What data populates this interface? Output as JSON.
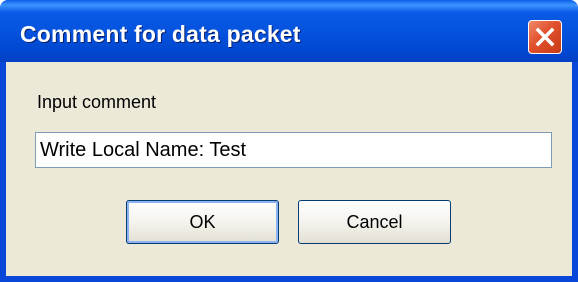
{
  "dialog": {
    "title": "Comment for data packet",
    "close_icon": "close-icon"
  },
  "form": {
    "label": "Input comment",
    "comment_value": "Write Local Name: Test"
  },
  "buttons": {
    "ok_label": "OK",
    "cancel_label": "Cancel"
  },
  "colors": {
    "titlebar": "#0553de",
    "dialog_background": "#ece9d8",
    "close_button": "#e0502c"
  }
}
